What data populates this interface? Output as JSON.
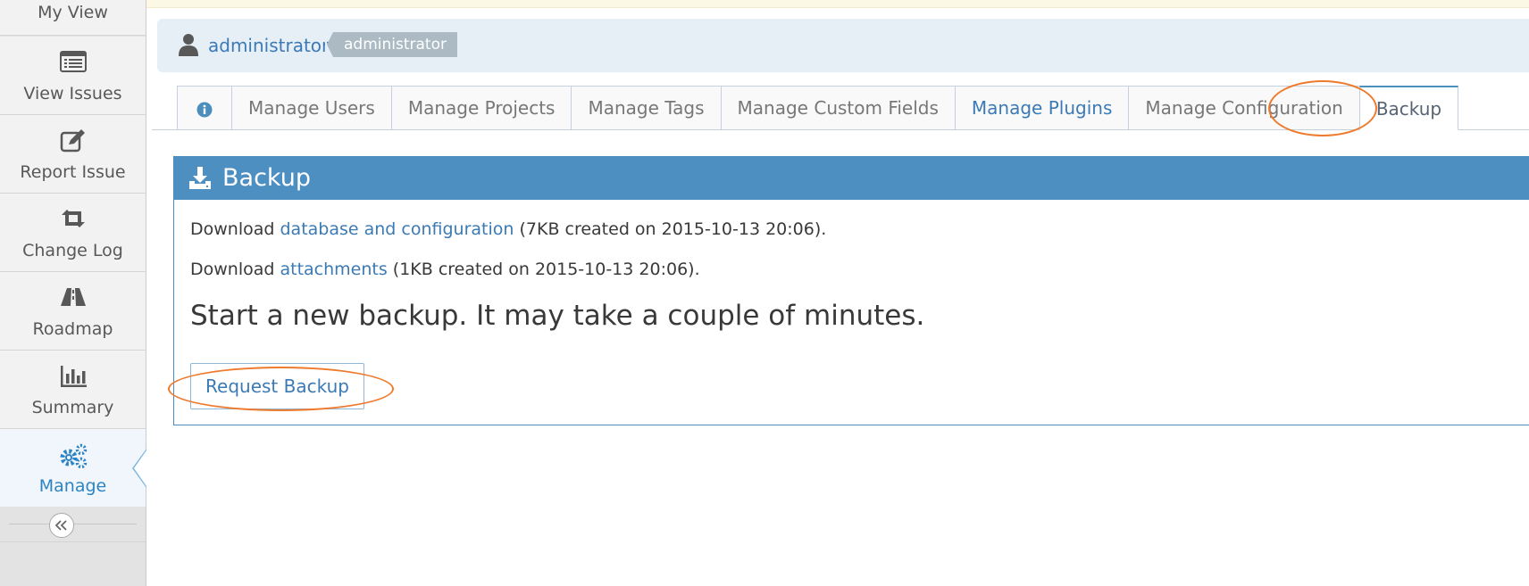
{
  "sidebar": {
    "items": [
      {
        "label": "My View",
        "icon": "dashboard-icon"
      },
      {
        "label": "View Issues",
        "icon": "list-icon"
      },
      {
        "label": "Report Issue",
        "icon": "edit-icon"
      },
      {
        "label": "Change Log",
        "icon": "retweet-icon"
      },
      {
        "label": "Roadmap",
        "icon": "road-icon"
      },
      {
        "label": "Summary",
        "icon": "bar-chart-icon"
      },
      {
        "label": "Manage",
        "icon": "gears-icon",
        "active": true
      }
    ],
    "collapse_icon": "double-angle-left-icon"
  },
  "breadcrumb": {
    "user_link": "administrator",
    "user_badge": "administrator"
  },
  "tabs": [
    {
      "label": "",
      "icon": "info-circle-icon"
    },
    {
      "label": "Manage Users"
    },
    {
      "label": "Manage Projects"
    },
    {
      "label": "Manage Tags"
    },
    {
      "label": "Manage Custom Fields"
    },
    {
      "label": "Manage Plugins"
    },
    {
      "label": "Manage Configuration"
    },
    {
      "label": "Backup",
      "active": true
    }
  ],
  "panel": {
    "title": "Backup",
    "icon": "download-icon",
    "downloads": [
      {
        "prefix": "Download ",
        "link": "database and configuration",
        "suffix": " (7KB created on 2015-10-13 20:06)."
      },
      {
        "prefix": "Download ",
        "link": "attachments",
        "suffix": " (1KB created on 2015-10-13 20:06)."
      }
    ],
    "start_text": "Start a new backup. It may take a couple of minutes.",
    "request_button": "Request Backup"
  },
  "colors": {
    "accent": "#4e8fc2",
    "link": "#3b7ab5",
    "annotation": "#ee7b2d"
  }
}
